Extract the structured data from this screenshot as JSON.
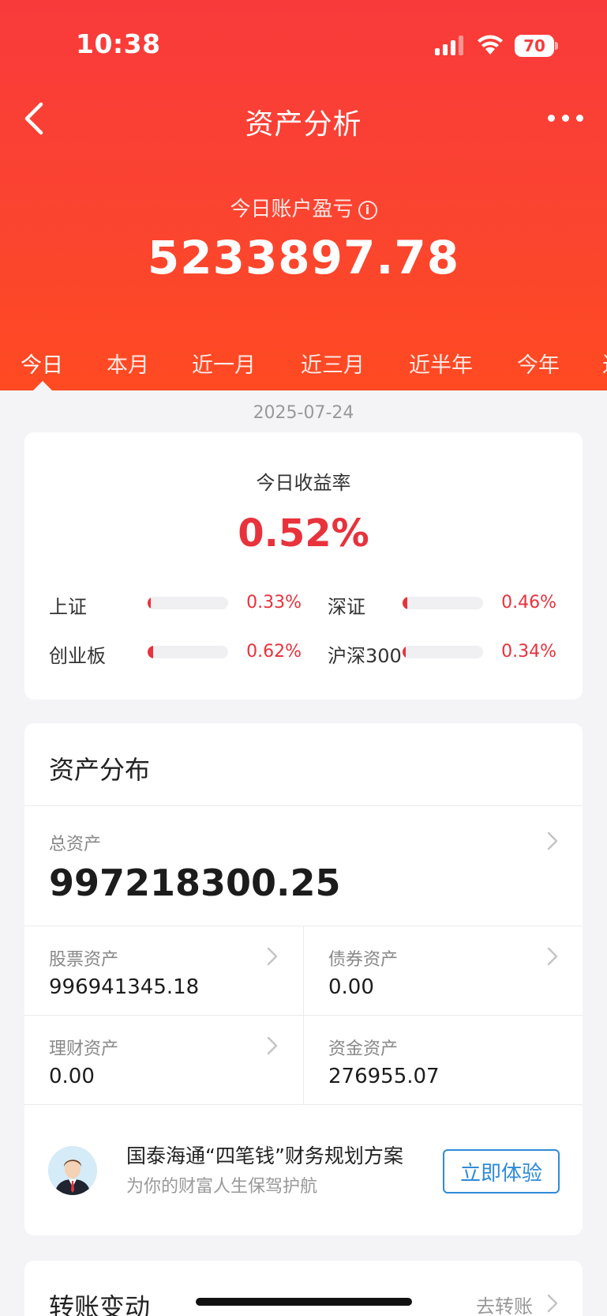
{
  "status_bar": {
    "time": "10:38",
    "battery": "70"
  },
  "nav": {
    "title": "资产分析"
  },
  "summary": {
    "pnl_label": "今日账户盈亏",
    "pnl_value": "5233897.78",
    "info_symbol": "i"
  },
  "period_tabs": [
    "今日",
    "本月",
    "近一月",
    "近三月",
    "近半年",
    "今年",
    "近"
  ],
  "date": "2025-07-24",
  "today_return": {
    "title": "今日收益率",
    "value": "0.52%",
    "indices": [
      {
        "name": "上证",
        "value": "0.33%",
        "fill": 0.33
      },
      {
        "name": "深证",
        "value": "0.46%",
        "fill": 0.46
      },
      {
        "name": "创业板",
        "value": "0.62%",
        "fill": 0.62
      },
      {
        "name": "沪深300",
        "value": "0.34%",
        "fill": 0.34
      }
    ]
  },
  "assets": {
    "title": "资产分布",
    "total_label": "总资产",
    "total_value": "997218300.25",
    "items": [
      {
        "label": "股票资产",
        "value": "996941345.18"
      },
      {
        "label": "债券资产",
        "value": "0.00"
      },
      {
        "label": "理财资产",
        "value": "0.00"
      },
      {
        "label": "资金资产",
        "value": "276955.07"
      }
    ]
  },
  "promo": {
    "title": "国泰海通“四笔钱”财务规划方案",
    "subtitle": "为你的财富人生保驾护航",
    "button": "立即体验"
  },
  "transfer": {
    "title": "转账变动",
    "link": "去转账"
  },
  "colors": {
    "brand_red": "#f93a3b",
    "up_red": "#e8323c",
    "link_blue": "#2f8bd8"
  }
}
